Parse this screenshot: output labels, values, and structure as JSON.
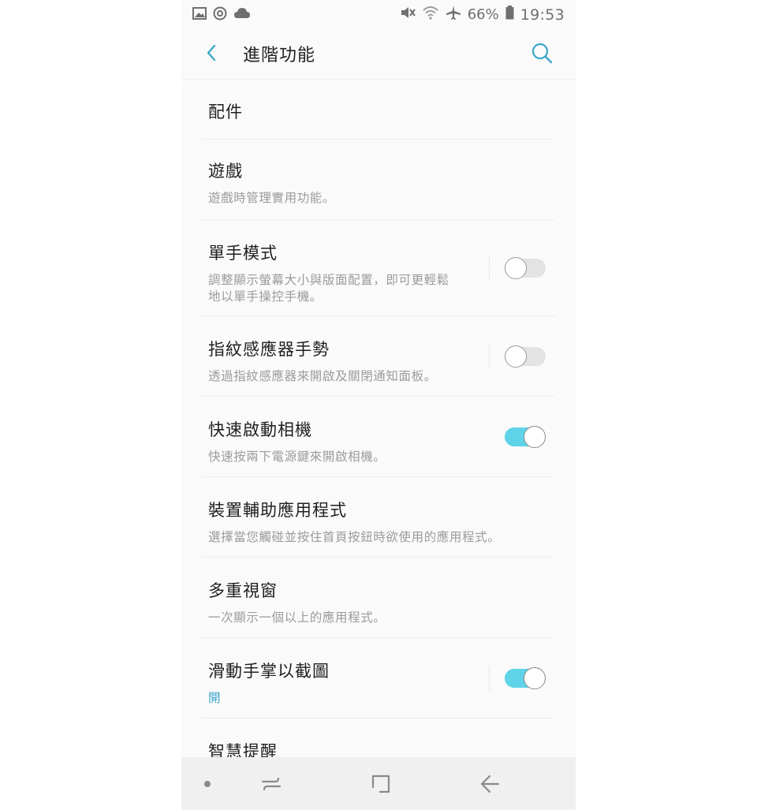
{
  "status_bar": {
    "battery_percent": "66%",
    "time": "19:53",
    "left_icons": [
      "gallery-icon",
      "sync-icon",
      "cloud-icon"
    ],
    "right_icons": [
      "mute-icon",
      "wifi-icon",
      "airplane-icon",
      "battery-icon"
    ]
  },
  "header": {
    "title": "進階功能"
  },
  "items": [
    {
      "title": "配件",
      "subtitle": ""
    },
    {
      "title": "遊戲",
      "subtitle": "遊戲時管理實用功能。"
    },
    {
      "title": "單手模式",
      "subtitle": "調整顯示螢幕大小與版面配置，即可更輕鬆地以單手操控手機。",
      "toggle": false
    },
    {
      "title": "指紋感應器手勢",
      "subtitle": "透過指紋感應器來開啟及關閉通知面板。",
      "toggle": false
    },
    {
      "title": "快速啟動相機",
      "subtitle": "快速按兩下電源鍵來開啟相機。",
      "toggle": true
    },
    {
      "title": "裝置輔助應用程式",
      "subtitle": "選擇當您觸碰並按住首頁按鈕時欲使用的應用程式。"
    },
    {
      "title": "多重視窗",
      "subtitle": "一次顯示一個以上的應用程式。"
    },
    {
      "title": "滑動手掌以截圖",
      "subtitle": "開",
      "toggle": true
    },
    {
      "title": "智慧提醒",
      "subtitle": ""
    }
  ],
  "colors": {
    "accent": "#3aa7c9",
    "toggle_on": "#5fd3e8",
    "toggle_off": "#e3e3e3"
  }
}
